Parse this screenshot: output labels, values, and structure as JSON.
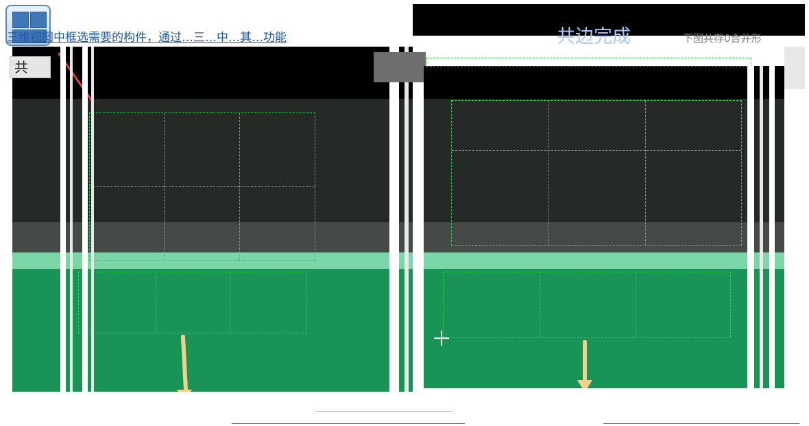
{
  "toolbar": {
    "icon": "grid-panel-icon"
  },
  "instruction": {
    "text": "三维视图中框选需要的构件，通过…三…中…其…功能"
  },
  "command": {
    "label": "共"
  },
  "banner": {
    "title": "共边完成",
    "right_text": "下图共存0合并形"
  },
  "colors": {
    "grid_line": "#22d84b",
    "arrow": "#f2d28b",
    "ground": "#1a9356"
  }
}
